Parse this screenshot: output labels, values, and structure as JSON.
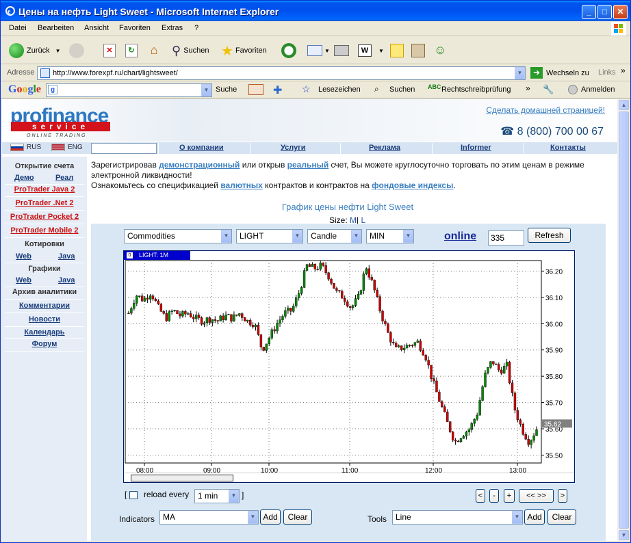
{
  "window": {
    "title": "Цены на нефть Light Sweet - Microsoft Internet Explorer",
    "minimize": "_",
    "maximize": "□",
    "close": "✕"
  },
  "menu": [
    "Datei",
    "Bearbeiten",
    "Ansicht",
    "Favoriten",
    "Extras",
    "?"
  ],
  "toolbar": {
    "back": "Zurück",
    "search": "Suchen",
    "favorites": "Favoriten"
  },
  "address": {
    "label": "Adresse",
    "url": "http://www.forexpf.ru/chart/lightsweet/",
    "go": "Wechseln zu",
    "links": "Links"
  },
  "google_bar": {
    "logo": "Google",
    "search": "Suche",
    "bookmarks": "Lesezeichen",
    "suchen": "Suchen",
    "spellcheck": "Rechtschreibprüfung",
    "signin": "Anmelden"
  },
  "site": {
    "logo_top": "profinance",
    "logo_mid": "service",
    "logo_sub": "ONLINE TRADING",
    "homepage_link": "Сделать домашней страницей!",
    "phone": "☎ 8 (800) 700 00 67",
    "lang_ru": "RUS",
    "lang_en": "ENG",
    "nav": [
      "О компании",
      "Услуги",
      "Реклама",
      "Informer",
      "Контакты"
    ]
  },
  "sidebar": {
    "open_account": "Открытие счета",
    "demo": "Демо",
    "real": "Реал",
    "products": [
      "ProTrader Java 2",
      "ProTrader .Net 2",
      "ProTrader Pocket 2",
      "ProTrader Mobile 2"
    ],
    "quotes": "Котировки",
    "quotes_web": "Web",
    "quotes_java": "Java",
    "charts": "Графики",
    "charts_web": "Web",
    "charts_java": "Java",
    "archive": "Архив аналитики",
    "links": [
      "Комментарии",
      "Новости",
      "Календарь",
      "Форум"
    ]
  },
  "intro": {
    "p1_a": "Зарегистрировав ",
    "p1_link1": "демонстрационный",
    "p1_b": " или открыв ",
    "p1_link2": "реальный",
    "p1_c": " счет, Вы можете круглосуточно торговать по этим ценам в режиме электронной ликвидности!",
    "p2_a": "Ознакомьтесь со спецификацией ",
    "p2_link1": "валютных",
    "p2_b": " контрактов и контрактов на ",
    "p2_link2": "фондовые индексы",
    "p2_c": "."
  },
  "chart_page": {
    "title": "График цены нефти Light Sweet",
    "size_label": "Size:",
    "size_m": "M",
    "size_l": "L",
    "sep": "|",
    "category": "Commodities",
    "symbol": "LIGHT",
    "type": "Candle",
    "period": "MIN",
    "online": "online",
    "count": "335",
    "refresh": "Refresh",
    "chart_label": "LIGHT: 1M",
    "reload_open": "[",
    "reload": "reload every",
    "reload_value": "1 min",
    "reload_close": "]",
    "nav_buttons": [
      "<",
      "-",
      "+",
      "<< >>",
      ">"
    ],
    "indicators_label": "Indicators",
    "indicator_value": "MA",
    "add": "Add",
    "clear": "Clear",
    "tools_label": "Tools",
    "tool_value": "Line"
  },
  "chart_data": {
    "type": "candlestick",
    "title": "LIGHT: 1M",
    "x_ticks": [
      "08:00",
      "09:00",
      "10:00",
      "11:00",
      "12:00",
      "13:00"
    ],
    "y_ticks": [
      36.2,
      36.1,
      36.0,
      35.9,
      35.8,
      35.7,
      35.6,
      35.5
    ],
    "ylim": [
      35.47,
      36.24
    ],
    "last_price": "35.62",
    "grid": true,
    "colors": {
      "up": "#008800",
      "down": "#cc0000",
      "wick": "#000000",
      "last_tag": "#808080"
    },
    "close_path": [
      [
        0,
        36.04
      ],
      [
        5,
        36.11
      ],
      [
        10,
        36.09
      ],
      [
        15,
        36.12
      ],
      [
        20,
        36.06
      ],
      [
        25,
        36.02
      ],
      [
        30,
        36.05
      ],
      [
        35,
        36.03
      ],
      [
        40,
        36.04
      ],
      [
        45,
        36.02
      ],
      [
        50,
        36.01
      ],
      [
        55,
        36.02
      ],
      [
        60,
        36.01
      ],
      [
        65,
        36.03
      ],
      [
        70,
        36.02
      ],
      [
        75,
        36.04
      ],
      [
        80,
        36.01
      ],
      [
        85,
        36.0
      ],
      [
        90,
        35.9
      ],
      [
        95,
        35.95
      ],
      [
        100,
        36.0
      ],
      [
        105,
        36.04
      ],
      [
        110,
        36.05
      ],
      [
        115,
        36.12
      ],
      [
        120,
        36.22
      ],
      [
        125,
        36.21
      ],
      [
        130,
        36.22
      ],
      [
        135,
        36.18
      ],
      [
        140,
        36.12
      ],
      [
        145,
        36.1
      ],
      [
        150,
        36.06
      ],
      [
        155,
        36.1
      ],
      [
        160,
        36.22
      ],
      [
        165,
        36.14
      ],
      [
        170,
        36.04
      ],
      [
        175,
        35.96
      ],
      [
        180,
        35.9
      ],
      [
        185,
        35.91
      ],
      [
        190,
        35.92
      ],
      [
        195,
        35.93
      ],
      [
        200,
        35.88
      ],
      [
        205,
        35.78
      ],
      [
        210,
        35.7
      ],
      [
        215,
        35.62
      ],
      [
        220,
        35.55
      ],
      [
        225,
        35.58
      ],
      [
        230,
        35.6
      ],
      [
        235,
        35.66
      ],
      [
        240,
        35.8
      ],
      [
        245,
        35.86
      ],
      [
        250,
        35.82
      ],
      [
        255,
        35.84
      ],
      [
        260,
        35.68
      ],
      [
        265,
        35.6
      ],
      [
        270,
        35.55
      ],
      [
        275,
        35.6
      ]
    ]
  }
}
